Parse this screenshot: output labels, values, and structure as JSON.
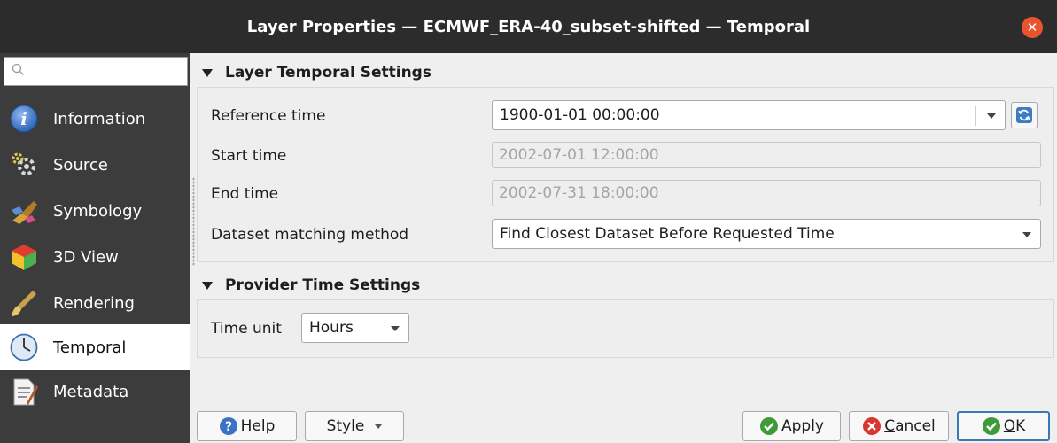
{
  "window": {
    "title": "Layer Properties — ECMWF_ERA-40_subset-shifted — Temporal",
    "close_icon": "close-icon",
    "accent_close": "#e9542f"
  },
  "sidebar": {
    "search": {
      "value": "",
      "placeholder": "",
      "icon": "search-icon"
    },
    "items": [
      {
        "label": "Information",
        "icon": "information-icon",
        "active": false
      },
      {
        "label": "Source",
        "icon": "source-icon",
        "active": false
      },
      {
        "label": "Symbology",
        "icon": "symbology-icon",
        "active": false
      },
      {
        "label": "3D View",
        "icon": "3d-view-icon",
        "active": false
      },
      {
        "label": "Rendering",
        "icon": "rendering-icon",
        "active": false
      },
      {
        "label": "Temporal",
        "icon": "clock-icon",
        "active": true
      },
      {
        "label": "Metadata",
        "icon": "metadata-icon",
        "active": false
      }
    ],
    "colors": {
      "background": "#3c3c3c",
      "active": "#ffffff"
    }
  },
  "layer_temporal": {
    "header": "Layer Temporal Settings",
    "reference_time": {
      "label": "Reference time",
      "value": "1900-01-01 00:00:00"
    },
    "start_time": {
      "label": "Start time",
      "value": "2002-07-01 12:00:00"
    },
    "end_time": {
      "label": "End time",
      "value": "2002-07-31 18:00:00"
    },
    "matching_method": {
      "label": "Dataset matching method",
      "value": "Find Closest Dataset Before Requested Time"
    }
  },
  "provider_time": {
    "header": "Provider Time Settings",
    "time_unit": {
      "label": "Time unit",
      "value": "Hours"
    }
  },
  "buttons": {
    "help": "Help",
    "style": "Style",
    "apply": "Apply",
    "cancel_prefix": "",
    "cancel_underlined": "C",
    "cancel_rest": "ancel",
    "ok_underlined": "O",
    "ok_rest": "K"
  }
}
